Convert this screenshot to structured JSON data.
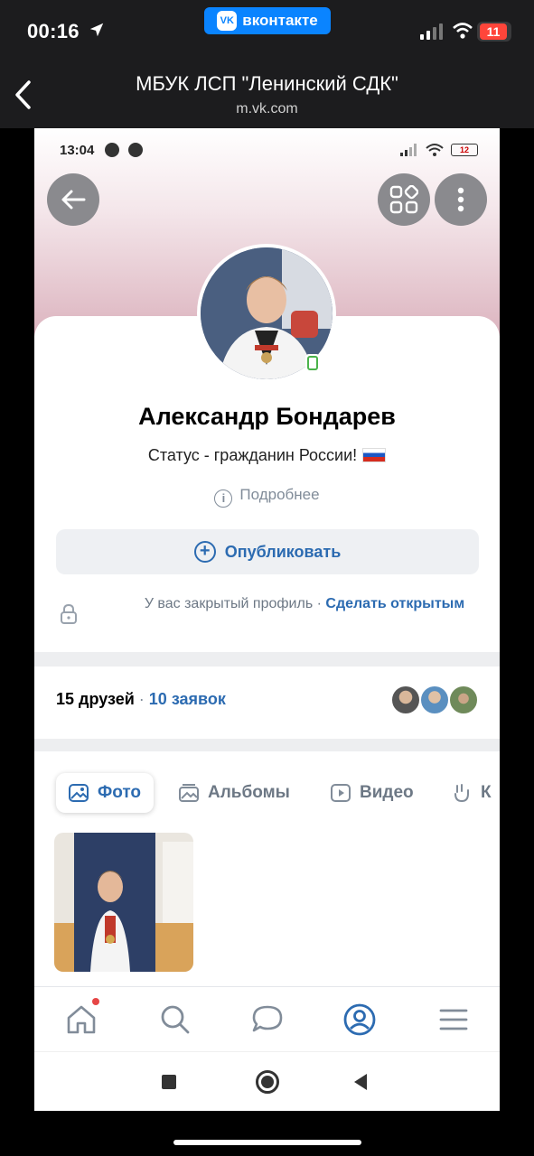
{
  "ios_status": {
    "time": "00:16",
    "app_badge": "вконтакте",
    "battery": "11"
  },
  "browser": {
    "title": "МБУК ЛСП \"Ленинский СДК\"",
    "url": "m.vk.com"
  },
  "android_status": {
    "time": "13:04",
    "battery": "12"
  },
  "profile": {
    "name": "Александр Бондарев",
    "status": "Статус - гражданин России!",
    "more": "Подробнее",
    "publish": "Опубликовать",
    "private_text": "У вас закрытый профиль ·",
    "private_link": "Сделать открытым"
  },
  "friends": {
    "count": "15 друзей",
    "separator": "·",
    "requests": "10 заявок"
  },
  "media_tabs": [
    {
      "label": "Фото"
    },
    {
      "label": "Альбомы"
    },
    {
      "label": "Видео"
    },
    {
      "label": "К"
    }
  ],
  "colors": {
    "accent": "#2c6bb1",
    "vk_blue": "#0a84ff",
    "battery_low": "#ff453a"
  }
}
